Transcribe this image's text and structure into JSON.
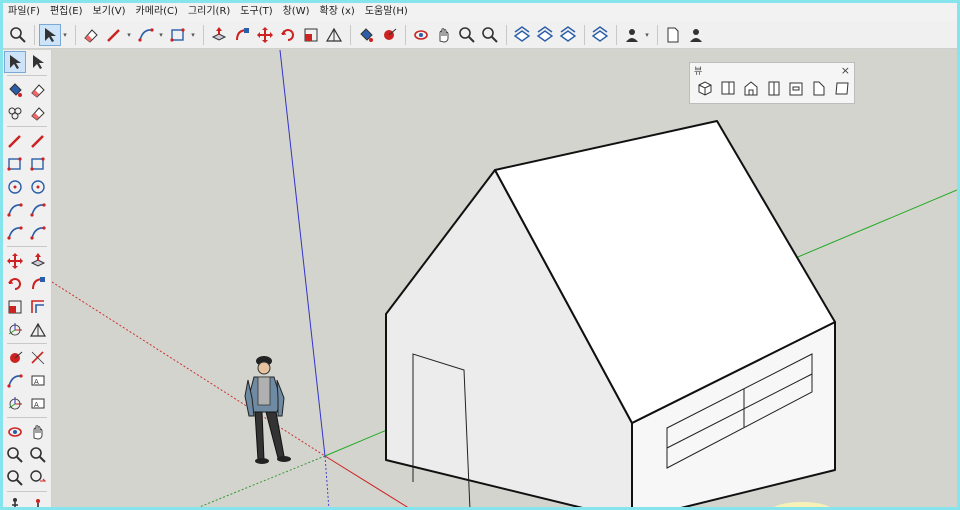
{
  "menu": [
    "파일(F)",
    "편집(E)",
    "보기(V)",
    "카메라(C)",
    "그리기(R)",
    "도구(T)",
    "창(W)",
    "확장 (x)",
    "도움말(H)"
  ],
  "toolbar": {
    "groups": [
      [
        "zoom-tool-icon"
      ],
      [
        "select-tool-icon"
      ],
      [
        "eraser-tool-icon",
        "pencil-line-icon",
        "arc-tool-icon",
        "rectangle-tool-icon"
      ],
      [
        "push-pull-icon",
        "follow-me-icon",
        "move-tool-icon",
        "rotate-tool-icon",
        "scale-tool-icon",
        "protractor-icon"
      ],
      [
        "paint-bucket-icon",
        "tape-measure-icon"
      ],
      [
        "orbit-icon",
        "pan-icon",
        "zoom-window-icon",
        "zoom-extents-icon"
      ],
      [
        "warehouse-icon",
        "extension-warehouse-icon",
        "layout-icon"
      ],
      [
        "send-to-layout-icon"
      ],
      [
        "profile-icon"
      ],
      [
        "new-file-icon",
        "user-account-icon"
      ]
    ]
  },
  "left_toolbar": [
    [
      "select-arrow-icon",
      "lasso-select-icon"
    ],
    [
      "paint-bucket-icon",
      "eraser-icon"
    ],
    [
      "tag-icon",
      "eraser-soft-icon"
    ],
    [
      "pencil-icon",
      "freehand-icon"
    ],
    [
      "rectangle-icon",
      "rotated-rectangle-icon"
    ],
    [
      "circle-icon",
      "polygon-icon"
    ],
    [
      "arc-icon",
      "two-point-arc-icon"
    ],
    [
      "pie-icon",
      "three-point-arc-icon"
    ],
    [
      "move-icon",
      "push-pull-icon"
    ],
    [
      "rotate-icon",
      "follow-me-icon"
    ],
    [
      "scale-icon",
      "offset-icon"
    ],
    [
      "axes-icon",
      "protractor-icon"
    ],
    [
      "tape-measure-icon",
      "dimension-icon"
    ],
    [
      "protractor-arc-icon",
      "text-label-icon"
    ],
    [
      "axes-tool-icon",
      "3d-text-icon"
    ],
    [
      "orbit-icon",
      "pan-icon"
    ],
    [
      "zoom-icon",
      "zoom-window-icon"
    ],
    [
      "zoom-extents-icon",
      "previous-view-icon"
    ],
    [
      "walk-icon",
      "position-camera-icon"
    ]
  ],
  "views_panel": {
    "title": "뷰",
    "close": "×",
    "items": [
      "iso-view-icon",
      "top-view-icon",
      "front-view-icon",
      "right-view-icon",
      "back-view-icon",
      "left-view-icon",
      "bottom-view-icon"
    ]
  },
  "colors": {
    "axis_red": "#cc2222",
    "axis_green": "#22aa22",
    "axis_blue": "#3333cc",
    "viewport_bg": "#d4d4cf",
    "house_face": "#ffffff",
    "house_shade": "#ececec"
  }
}
